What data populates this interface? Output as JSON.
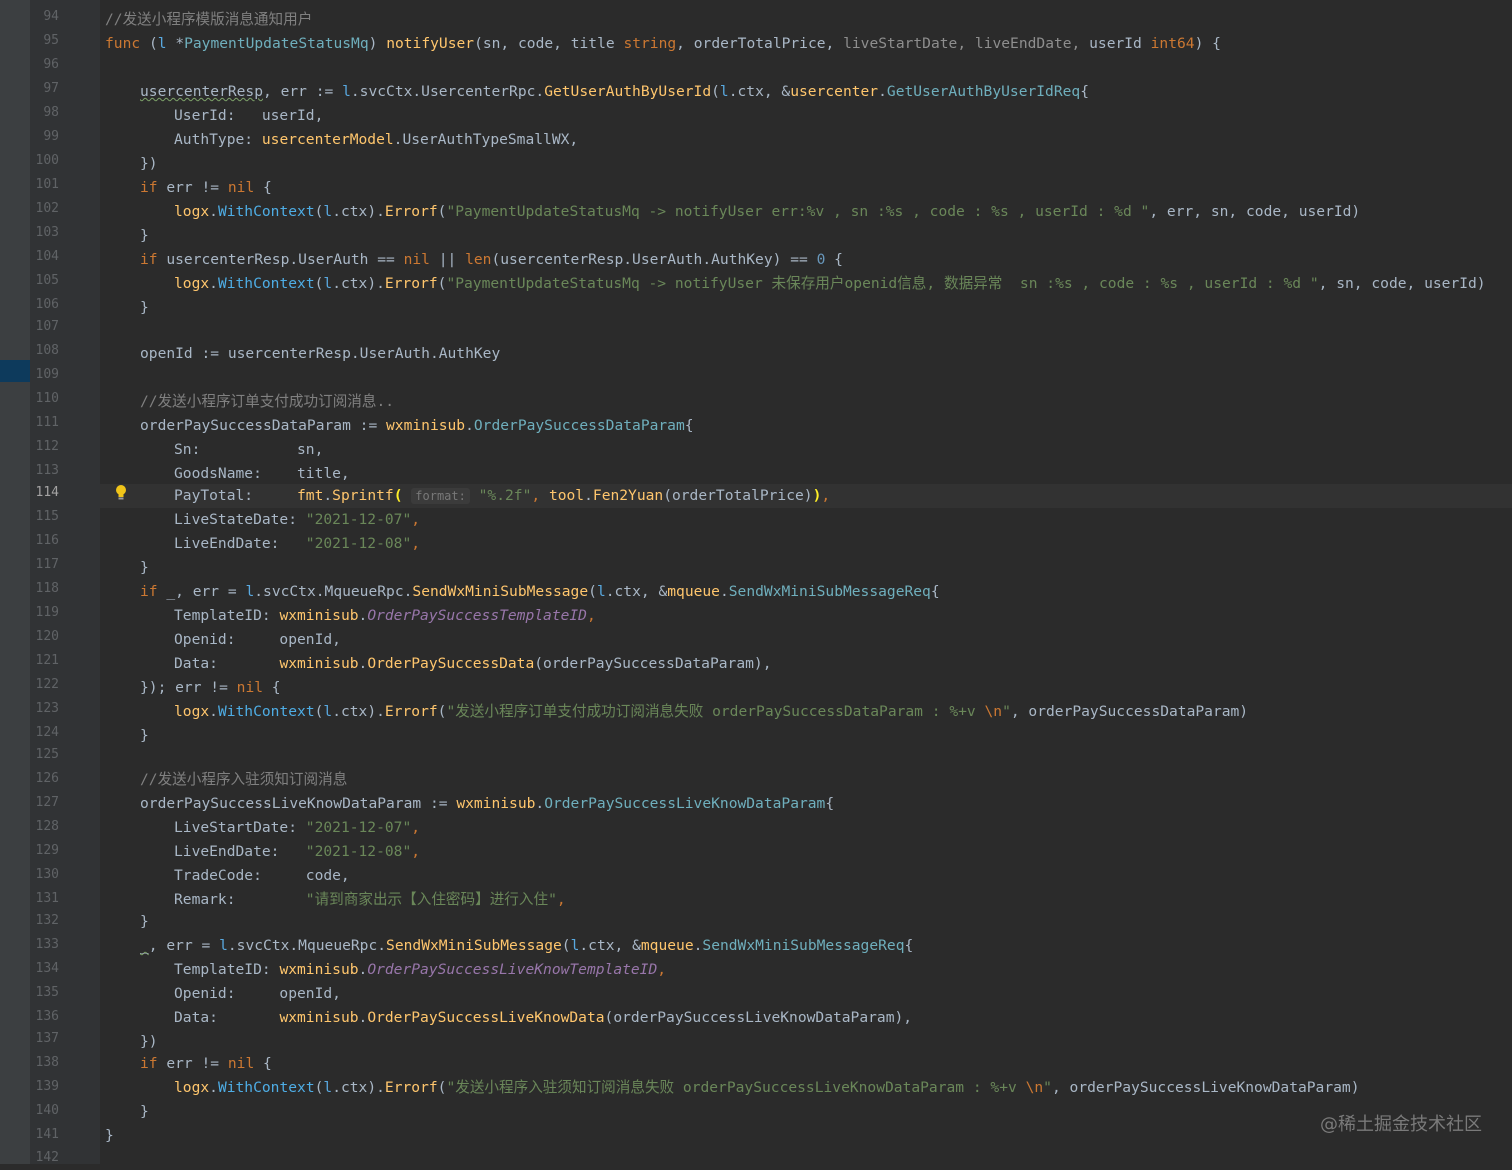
{
  "editor": {
    "current_line": "114",
    "line_numbers": [
      "94",
      "95",
      "96",
      "97",
      "98",
      "99",
      "100",
      "101",
      "102",
      "103",
      "104",
      "105",
      "106",
      "107",
      "108",
      "109",
      "110",
      "111",
      "112",
      "113",
      "114",
      "115",
      "116",
      "117",
      "118",
      "119",
      "120",
      "121",
      "122",
      "123",
      "124",
      "125",
      "126",
      "127",
      "128",
      "129",
      "130",
      "131",
      "132",
      "133",
      "134",
      "135",
      "136",
      "137",
      "138",
      "139",
      "140",
      "141",
      "142"
    ],
    "code": {
      "c94": "//发送小程序模版消息通知用户",
      "c95a": "func",
      "c95b": " (",
      "c95c": "l",
      "c95d": " *",
      "c95e": "PaymentUpdateStatusMq",
      "c95f": ") ",
      "c95g": "notifyUser",
      "c95h": "(sn, code, title ",
      "c95i": "string",
      "c95j": ", orderTotalPrice, ",
      "c95k": "liveStartDate, liveEndDate,",
      "c95l": " userId ",
      "c95m": "int64",
      "c95n": ") {",
      "c97a": "usercenterResp",
      "c97b": ", err := ",
      "c97c": "l",
      "c97d": ".svcCtx.UsercenterRpc.",
      "c97e": "GetUserAuthByUserId",
      "c97f": "(",
      "c97g": "l",
      "c97h": ".ctx, &",
      "c97i": "usercenter",
      "c97j": ".",
      "c97k": "GetUserAuthByUserIdReq",
      "c97l": "{",
      "c98": "UserId:   userId,",
      "c99a": "AuthType: ",
      "c99b": "usercenterModel",
      "c99c": ".UserAuthTypeSmallWX,",
      "c100": "})",
      "c101a": "if",
      "c101b": " err != ",
      "c101c": "nil",
      "c101d": " {",
      "c102a": "logx",
      "c102b": ".",
      "c102c": "WithContext",
      "c102d": "(",
      "c102e": "l",
      "c102f": ".ctx).",
      "c102g": "Errorf",
      "c102h": "(",
      "c102i": "\"PaymentUpdateStatusMq -> notifyUser err:%v , sn :%s , code : %s , userId : %d \"",
      "c102j": ", err, sn, code, userId)",
      "c103": "}",
      "c104a": "if",
      "c104b": " usercenterResp.UserAuth == ",
      "c104c": "nil",
      "c104d": " || ",
      "c104e": "len",
      "c104f": "(usercenterResp.UserAuth.AuthKey) == ",
      "c104g": "0",
      "c104h": " {",
      "c105a": "logx",
      "c105b": ".",
      "c105c": "WithContext",
      "c105d": "(",
      "c105e": "l",
      "c105f": ".ctx).",
      "c105g": "Errorf",
      "c105h": "(",
      "c105i": "\"PaymentUpdateStatusMq -> notifyUser 未保存用户openid信息, 数据异常  sn :%s , code : %s , userId : %d \"",
      "c105j": ", sn, code, userId)",
      "c106": "}",
      "c108": "openId := usercenterResp.UserAuth.AuthKey",
      "c110": "//发送小程序订单支付成功订阅消息..",
      "c111a": "orderPaySuccessDataParam := ",
      "c111b": "wxminisub",
      "c111c": ".",
      "c111d": "OrderPaySuccessDataParam",
      "c111e": "{",
      "c112": "Sn:           sn,",
      "c113": "GoodsName:    title,",
      "c114a": "PayTotal:     ",
      "c114b": "fmt",
      "c114c": ".",
      "c114d": "Sprintf",
      "c114e": "(",
      "c114f": "format:",
      "c114g": " \"%.2f\"",
      "c114h": ", ",
      "c114i": "tool",
      "c114j": ".",
      "c114k": "Fen2Yuan",
      "c114l": "(orderTotalPrice)",
      "c114m": ")",
      "c114n": ",",
      "c115a": "LiveStateDate: ",
      "c115b": "\"2021-12-07\"",
      "c115c": ",",
      "c116a": "LiveEndDate:   ",
      "c116b": "\"2021-12-08\"",
      "c116c": ",",
      "c117": "}",
      "c118a": "if",
      "c118b": " _, err = ",
      "c118c": "l",
      "c118d": ".svcCtx.MqueueRpc.",
      "c118e": "SendWxMiniSubMessage",
      "c118f": "(",
      "c118g": "l",
      "c118h": ".ctx, &",
      "c118i": "mqueue",
      "c118j": ".",
      "c118k": "SendWxMiniSubMessageReq",
      "c118l": "{",
      "c119a": "TemplateID: ",
      "c119b": "wxminisub",
      "c119c": ".",
      "c119d": "OrderPaySuccessTemplateID",
      "c119e": ",",
      "c120": "Openid:     openId,",
      "c121a": "Data:       ",
      "c121b": "wxminisub",
      "c121c": ".",
      "c121d": "OrderPaySuccessData",
      "c121e": "(orderPaySuccessDataParam),",
      "c122a": "}); err != ",
      "c122b": "nil",
      "c122c": " {",
      "c123a": "logx",
      "c123b": ".",
      "c123c": "WithContext",
      "c123d": "(",
      "c123e": "l",
      "c123f": ".ctx).",
      "c123g": "Errorf",
      "c123h": "(",
      "c123i": "\"发送小程序订单支付成功订阅消息失败 orderPaySuccessDataParam : %+v ",
      "c123j": "\\n",
      "c123k": "\"",
      "c123l": ", orderPaySuccessDataParam)",
      "c124": "}",
      "c126": "//发送小程序入驻须知订阅消息",
      "c127a": "orderPaySuccessLiveKnowDataParam := ",
      "c127b": "wxminisub",
      "c127c": ".",
      "c127d": "OrderPaySuccessLiveKnowDataParam",
      "c127e": "{",
      "c128a": "LiveStartDate: ",
      "c128b": "\"2021-12-07\"",
      "c128c": ",",
      "c129a": "LiveEndDate:   ",
      "c129b": "\"2021-12-08\"",
      "c129c": ",",
      "c130": "TradeCode:     code,",
      "c131a": "Remark:        ",
      "c131b": "\"请到商家出示【入住密码】进行入住\"",
      "c131c": ",",
      "c132": "}",
      "c133a": "_",
      "c133b": ", err = ",
      "c133c": "l",
      "c133d": ".svcCtx.MqueueRpc.",
      "c133e": "SendWxMiniSubMessage",
      "c133f": "(",
      "c133g": "l",
      "c133h": ".ctx, &",
      "c133i": "mqueue",
      "c133j": ".",
      "c133k": "SendWxMiniSubMessageReq",
      "c133l": "{",
      "c134a": "TemplateID: ",
      "c134b": "wxminisub",
      "c134c": ".",
      "c134d": "OrderPaySuccessLiveKnowTemplateID",
      "c134e": ",",
      "c135": "Openid:     openId,",
      "c136a": "Data:       ",
      "c136b": "wxminisub",
      "c136c": ".",
      "c136d": "OrderPaySuccessLiveKnowData",
      "c136e": "(orderPaySuccessLiveKnowDataParam),",
      "c137": "})",
      "c138a": "if",
      "c138b": " err != ",
      "c138c": "nil",
      "c138d": " {",
      "c139a": "logx",
      "c139b": ".",
      "c139c": "WithContext",
      "c139d": "(",
      "c139e": "l",
      "c139f": ".ctx).",
      "c139g": "Errorf",
      "c139h": "(",
      "c139i": "\"发送小程序入驻须知订阅消息失败 orderPaySuccessLiveKnowDataParam : %+v ",
      "c139j": "\\n",
      "c139k": "\"",
      "c139l": ", orderPaySuccessLiveKnowDataParam)",
      "c140": "}",
      "c141": "}"
    }
  },
  "watermark": "@稀土掘金技术社区",
  "colors": {
    "background": "#2b2b2b",
    "gutter": "#313335",
    "keyword": "#cc7832",
    "function": "#ffc66d",
    "string": "#6a8759",
    "comment": "#808080",
    "number": "#6897bb",
    "type": "#6fafbd",
    "global_const": "#9876aa"
  },
  "icons": {
    "intention": "lightbulb-icon"
  }
}
